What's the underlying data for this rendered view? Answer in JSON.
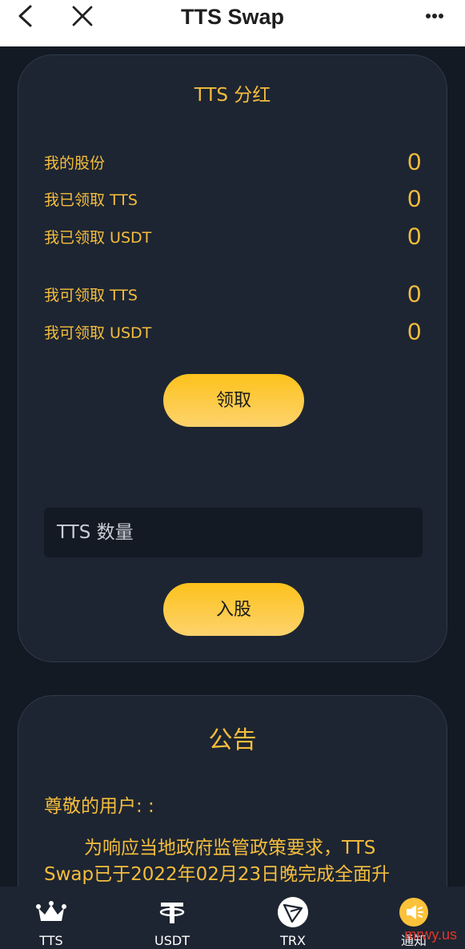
{
  "header": {
    "title": "TTS Swap"
  },
  "dividend": {
    "title": "TTS 分红",
    "rows": [
      {
        "label": "我的股份",
        "value": "0"
      },
      {
        "label": "我已领取 TTS",
        "value": "0"
      },
      {
        "label": "我已领取 USDT",
        "value": "0"
      },
      {
        "label": "我可领取 TTS",
        "value": "0"
      },
      {
        "label": "我可领取 USDT",
        "value": "0"
      }
    ],
    "claim_button": "领取",
    "amount_placeholder": "TTS 数量",
    "join_button": "入股"
  },
  "notice": {
    "title": "公告",
    "greeting": "尊敬的用户: :",
    "body": "为响应当地政府监管政策要求，TTS Swap已于2022年02月23日晚完成全面升"
  },
  "bottom_nav": [
    {
      "label": "TTS",
      "icon": "crown-icon"
    },
    {
      "label": "USDT",
      "icon": "tether-icon"
    },
    {
      "label": "TRX",
      "icon": "tron-icon"
    },
    {
      "label": "通知",
      "icon": "megaphone-icon"
    }
  ],
  "watermark": "mrwy.us",
  "colors": {
    "accent": "#f5bd3c",
    "background": "#141a24",
    "card": "#1d2532",
    "button": "#fdc21c"
  }
}
